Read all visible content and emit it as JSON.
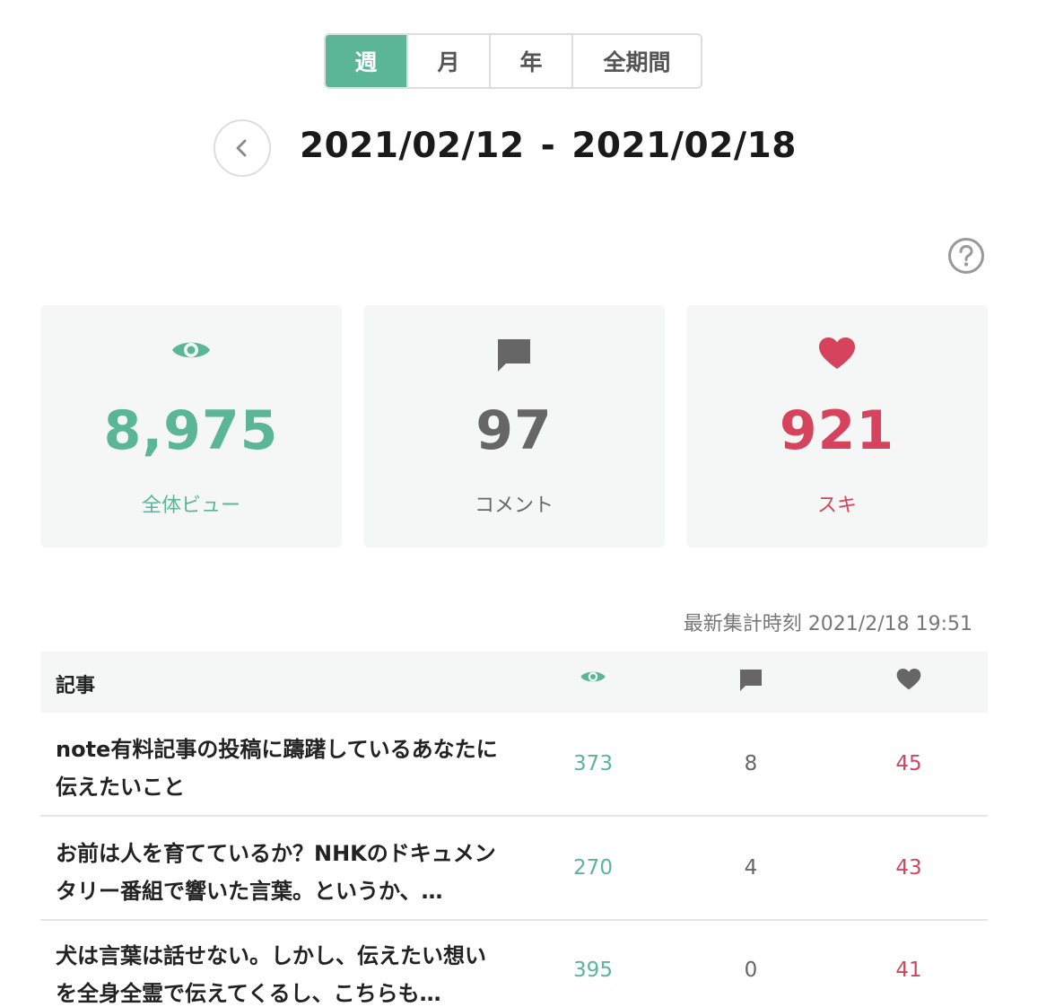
{
  "period_tabs": [
    {
      "label": "週",
      "active": true
    },
    {
      "label": "月",
      "active": false
    },
    {
      "label": "年",
      "active": false
    },
    {
      "label": "全期間",
      "active": false
    }
  ],
  "date_range": {
    "start": "2021/02/12",
    "separator": "-",
    "end": "2021/02/18"
  },
  "stats": [
    {
      "icon": "eye-icon",
      "value": "8,975",
      "label": "全体ビュー",
      "color": "#5bb597"
    },
    {
      "icon": "comment-icon",
      "value": "97",
      "label": "コメント",
      "color": "#666666"
    },
    {
      "icon": "heart-icon",
      "value": "921",
      "label": "スキ",
      "color": "#d5445c"
    }
  ],
  "updated_at": "最新集計時刻 2021/2/18 19:51",
  "table": {
    "header_title": "記事",
    "header_icons": [
      "eye-icon",
      "comment-icon",
      "heart-icon"
    ],
    "rows": [
      {
        "title": "note有料記事の投稿に躊躇しているあなたに伝えたいこと",
        "views": "373",
        "comments": "8",
        "likes": "45"
      },
      {
        "title": "お前は人を育てているか？NHKのドキュメンタリー番組で響いた言葉。というか、…",
        "views": "270",
        "comments": "4",
        "likes": "43"
      },
      {
        "title": "犬は言葉は話せない。しかし、伝えたい想いを全身全霊で伝えてくるし、こちらも…",
        "views": "395",
        "comments": "0",
        "likes": "41"
      }
    ]
  },
  "colors": {
    "accent": "#5bb597",
    "like": "#d5445c",
    "muted": "#666666"
  }
}
